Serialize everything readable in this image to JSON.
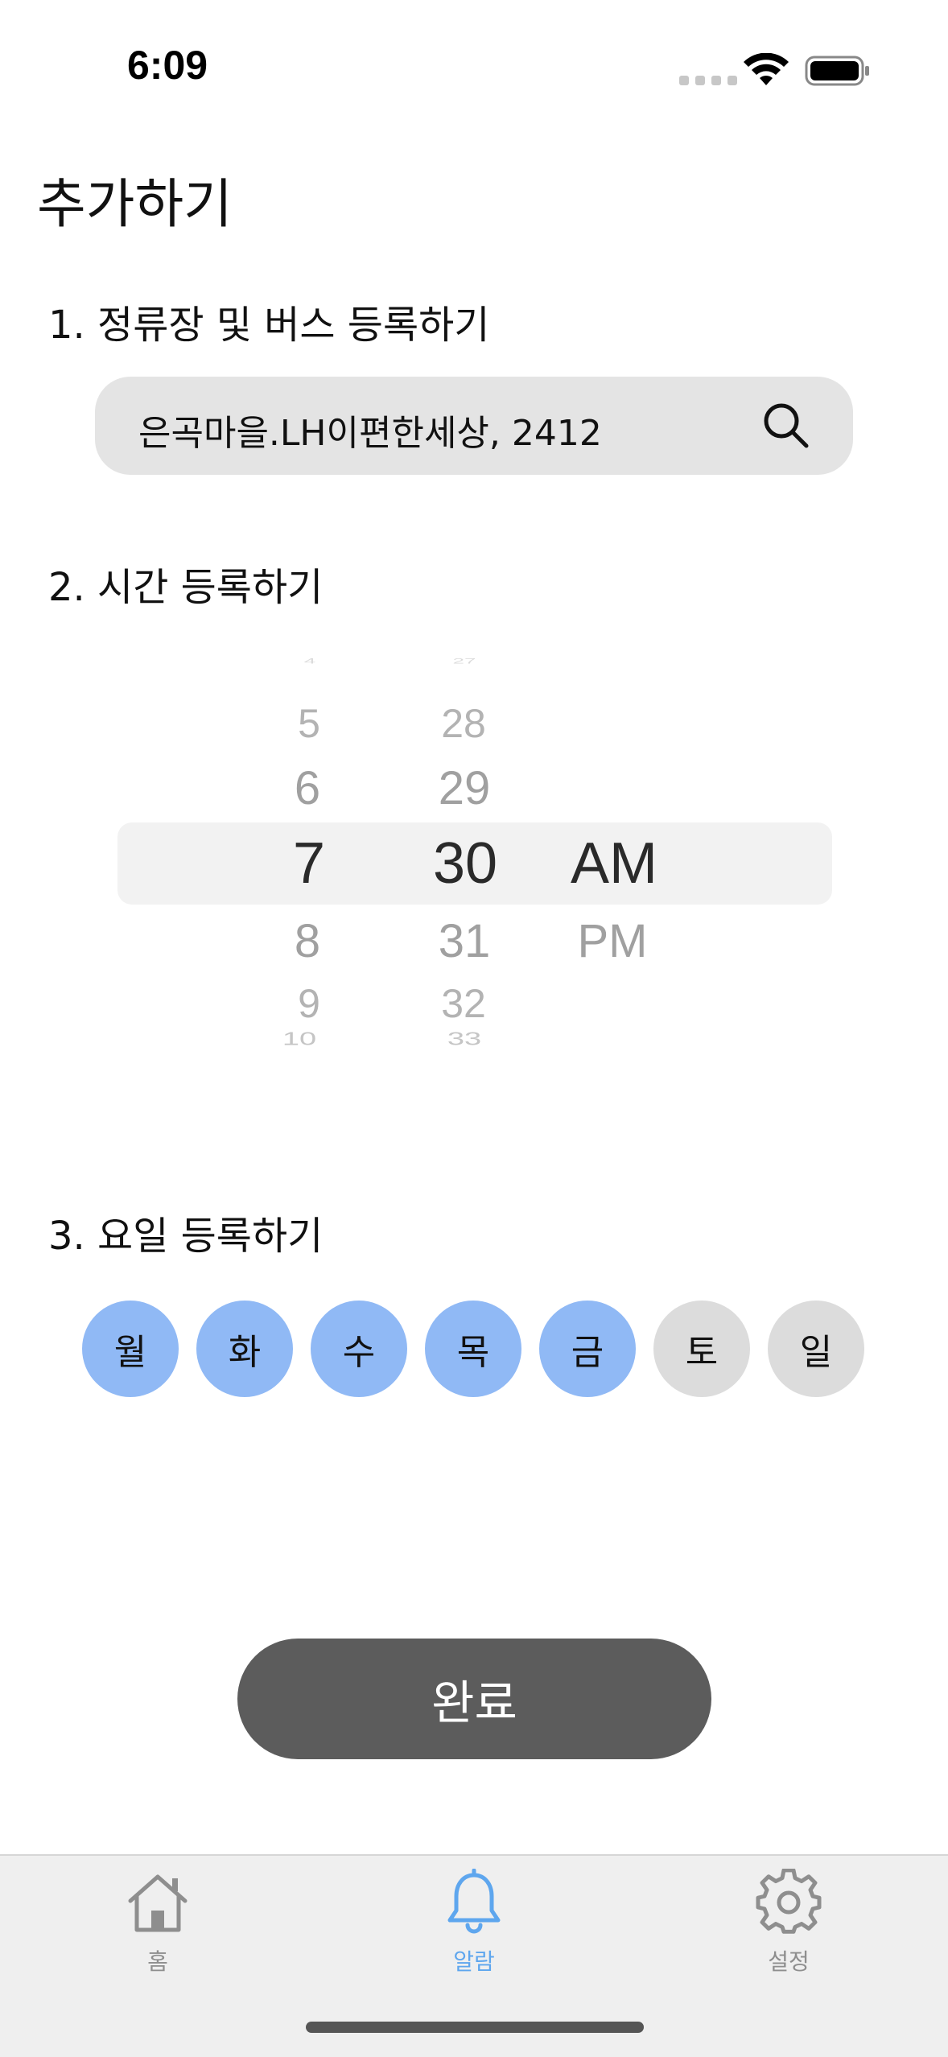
{
  "status_bar": {
    "time": "6:09"
  },
  "page_title": "추가하기",
  "section1": {
    "label": "1. 정류장 및 버스 등록하기",
    "search_value": "은곡마을.LH이편한세상, 2412"
  },
  "section2": {
    "label": "2. 시간 등록하기",
    "picker": {
      "hours": [
        "4",
        "5",
        "6",
        "7",
        "8",
        "9",
        "10"
      ],
      "minutes": [
        "27",
        "28",
        "29",
        "30",
        "31",
        "32",
        "33"
      ],
      "periods": [
        "AM",
        "PM"
      ],
      "selected": {
        "hour": "7",
        "minute": "30",
        "period": "AM"
      }
    }
  },
  "section3": {
    "label": "3. 요일 등록하기",
    "days": [
      {
        "label": "월",
        "selected": true
      },
      {
        "label": "화",
        "selected": true
      },
      {
        "label": "수",
        "selected": true
      },
      {
        "label": "목",
        "selected": true
      },
      {
        "label": "금",
        "selected": true
      },
      {
        "label": "토",
        "selected": false
      },
      {
        "label": "일",
        "selected": false
      }
    ]
  },
  "done_button": "완료",
  "tabbar": {
    "active_color": "#5ea6ee",
    "inactive_color": "#8e8e8e",
    "items": [
      {
        "label": "홈",
        "icon": "house-icon",
        "active": false
      },
      {
        "label": "알람",
        "icon": "bell-icon",
        "active": true
      },
      {
        "label": "설정",
        "icon": "gear-icon",
        "active": false
      }
    ]
  }
}
